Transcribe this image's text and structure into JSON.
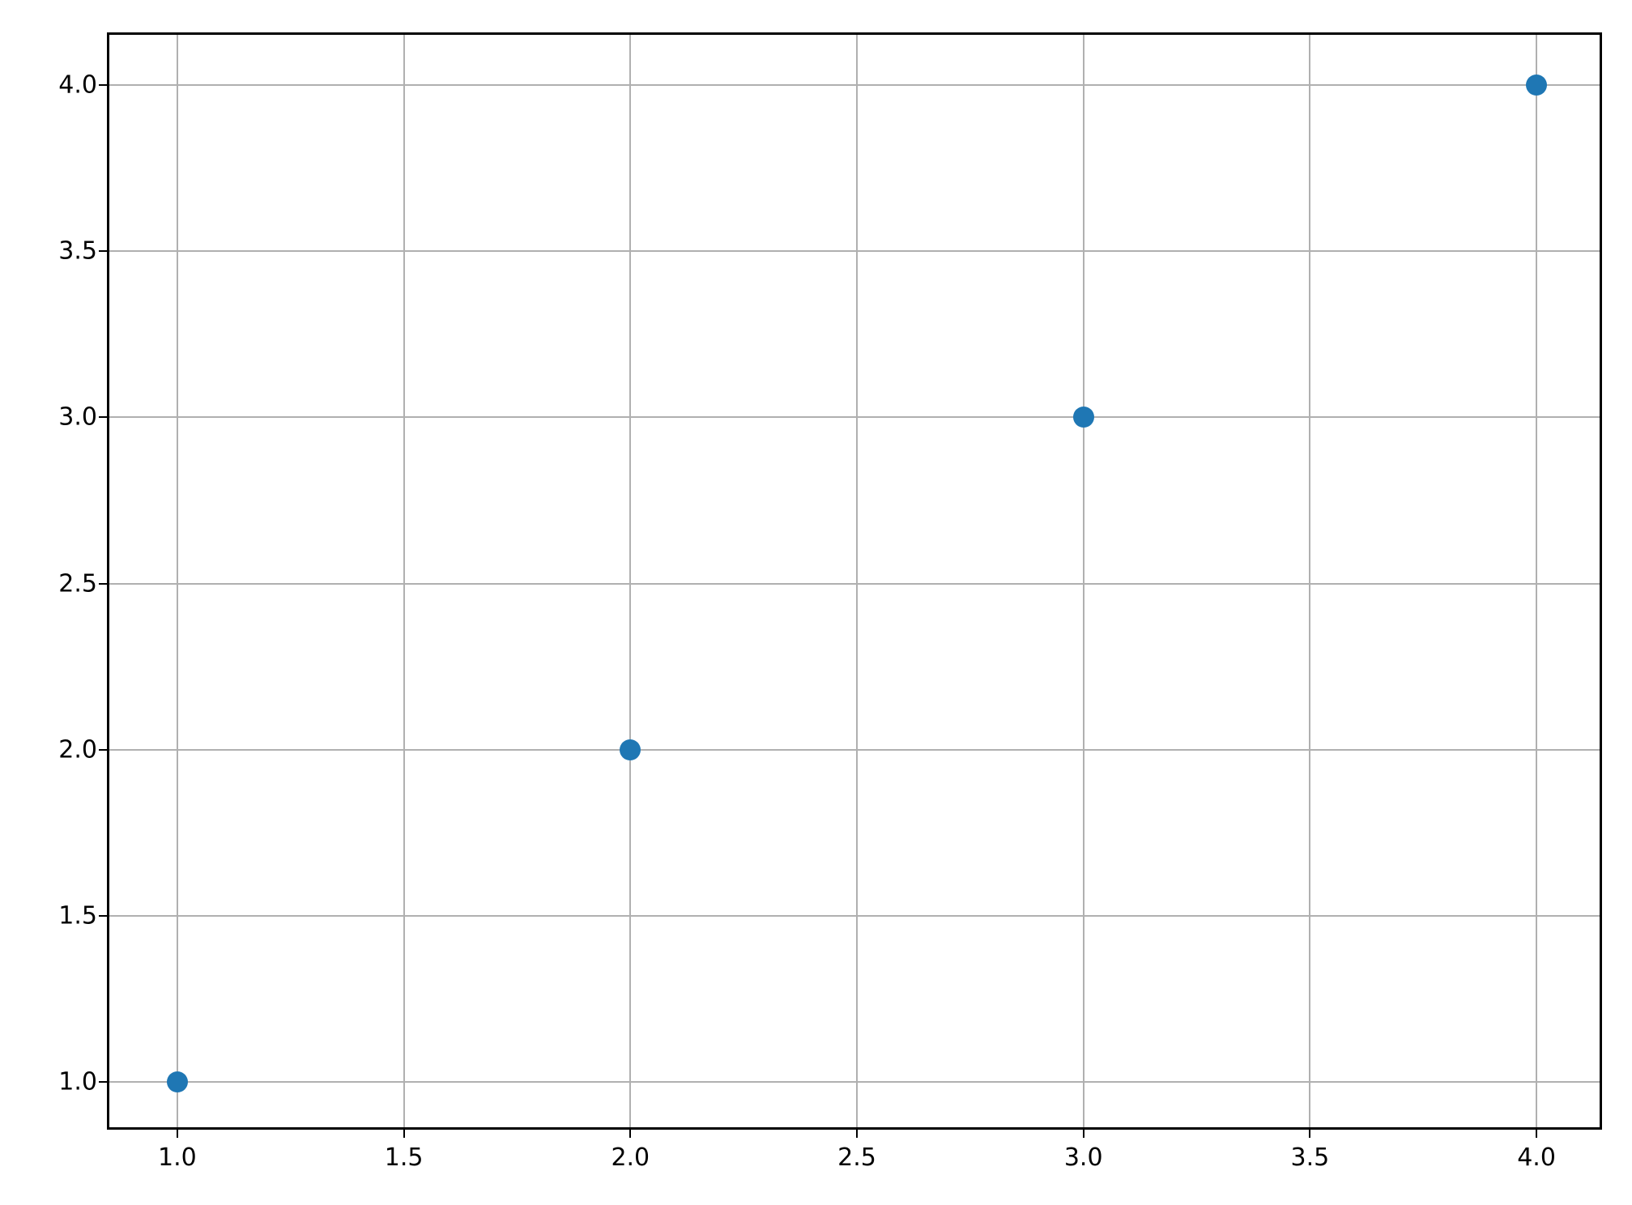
{
  "chart_data": {
    "type": "scatter",
    "x": [
      1,
      2,
      3,
      4
    ],
    "y": [
      1,
      2,
      3,
      4
    ],
    "title": "",
    "xlabel": "",
    "ylabel": "",
    "xlim": [
      0.85,
      4.15
    ],
    "ylim": [
      0.85,
      4.15
    ],
    "xticks": [
      1.0,
      1.5,
      2.0,
      2.5,
      3.0,
      3.5,
      4.0
    ],
    "yticks": [
      1.0,
      1.5,
      2.0,
      2.5,
      3.0,
      3.5,
      4.0
    ],
    "xticklabels": [
      "1.0",
      "1.5",
      "2.0",
      "2.5",
      "3.0",
      "3.5",
      "4.0"
    ],
    "yticklabels": [
      "1.0",
      "1.5",
      "2.0",
      "2.5",
      "3.0",
      "3.5",
      "4.0"
    ],
    "grid": true,
    "marker_color": "#1f77b4"
  }
}
